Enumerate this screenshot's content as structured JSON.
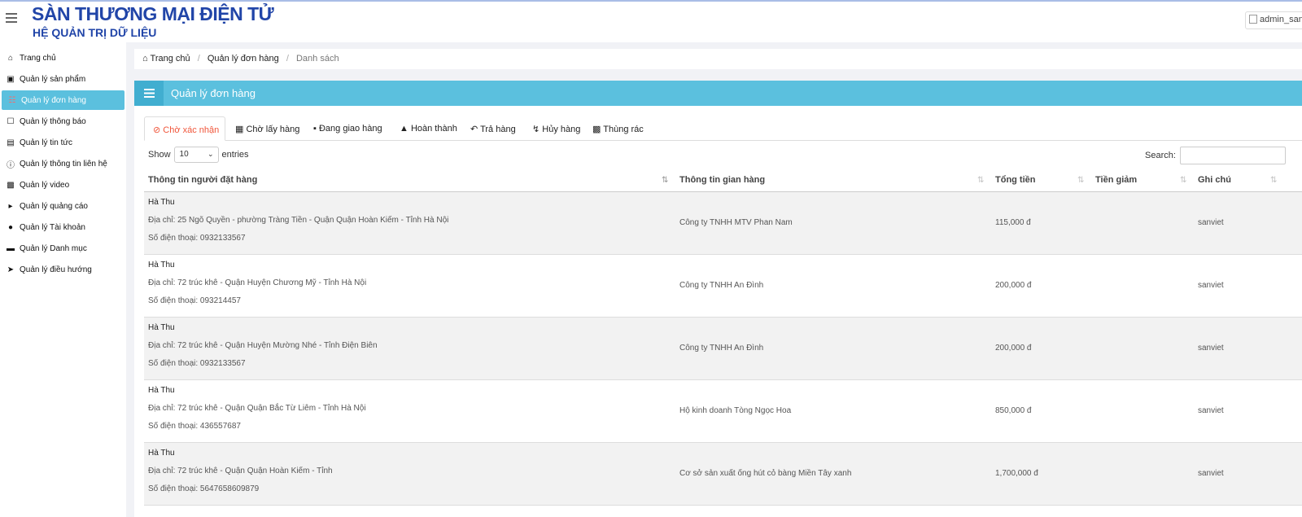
{
  "header": {
    "logo_title": "SÀN THƯƠNG MẠI ĐIỆN TỬ",
    "logo_subtitle": "HỆ QUẢN TRỊ DỮ LIỆU",
    "user_label": "admin_san"
  },
  "sidebar": {
    "items": [
      {
        "label": "Trang chủ",
        "icon": "home-icon"
      },
      {
        "label": "Quản lý sản phẩm",
        "icon": "archive-icon"
      },
      {
        "label": "Quản lý đơn hàng",
        "icon": "cart-icon",
        "active": true
      },
      {
        "label": "Quản lý thông báo",
        "icon": "bookmark-icon"
      },
      {
        "label": "Quản lý tin tức",
        "icon": "newspaper-icon"
      },
      {
        "label": "Quản lý thông tin liên hệ",
        "icon": "question-icon"
      },
      {
        "label": "Quản lý video",
        "icon": "video-icon"
      },
      {
        "label": "Quản lý quảng cáo",
        "icon": "megaphone-icon"
      },
      {
        "label": "Quản lý Tài khoản",
        "icon": "users-icon"
      },
      {
        "label": "Quản lý Danh mục",
        "icon": "folder-icon"
      },
      {
        "label": "Quản lý điều hướng",
        "icon": "location-arrow-icon"
      }
    ]
  },
  "breadcrumb": {
    "home": "Trang chủ",
    "section": "Quản lý đơn hàng",
    "current": "Danh sách"
  },
  "panel": {
    "title": "Quản lý đơn hàng"
  },
  "tabs": [
    {
      "label": "Chờ xác nhận",
      "icon": "circle-x-icon",
      "active": true
    },
    {
      "label": "Chờ lấy hàng",
      "icon": "gift-icon"
    },
    {
      "label": "Đang giao hàng",
      "icon": "truck-icon"
    },
    {
      "label": "Hoàn thành",
      "icon": "bell-icon"
    },
    {
      "label": "Trả hàng",
      "icon": "reply-icon"
    },
    {
      "label": "Hủy hàng",
      "icon": "bolt-icon"
    },
    {
      "label": "Thùng rác",
      "icon": "trash-icon"
    }
  ],
  "table_controls": {
    "show_label": "Show",
    "page_size": "10",
    "entries_label": "entries",
    "search_label": "Search:"
  },
  "columns": [
    "Thông tin người đặt hàng",
    "Thông tin gian hàng",
    "Tổng tiền",
    "Tiền giảm",
    "Ghi chú"
  ],
  "rows": [
    {
      "name": "Hà Thu",
      "address": "Địa chỉ: 25 Ngõ Quyền - phường Tràng Tiền - Quận Quận Hoàn Kiếm - Tỉnh Hà Nội",
      "phone": "Số điện thoại: 0932133567",
      "shop": "Công ty TNHH MTV Phan Nam",
      "total": "115,000 đ",
      "discount": "",
      "note": "sanviet"
    },
    {
      "name": "Hà Thu",
      "address": "Địa chỉ: 72 trúc khê - Quận Huyện Chương Mỹ - Tỉnh Hà Nội",
      "phone": "Số điện thoại: 093214457",
      "shop": "Công ty TNHH An Đình",
      "total": "200,000 đ",
      "discount": "",
      "note": "sanviet"
    },
    {
      "name": "Hà Thu",
      "address": "Địa chỉ: 72 trúc khê - Quận Huyện Mường Nhé - Tỉnh Điện Biên",
      "phone": "Số điện thoại: 0932133567",
      "shop": "Công ty TNHH An Đình",
      "total": "200,000 đ",
      "discount": "",
      "note": "sanviet"
    },
    {
      "name": "Hà Thu",
      "address": "Địa chỉ: 72 trúc khê - Quận Quận Bắc Từ Liêm - Tỉnh Hà Nội",
      "phone": "Số điện thoại: 436557687",
      "shop": "Hộ kinh doanh Tòng Ngọc Hoa",
      "total": "850,000 đ",
      "discount": "",
      "note": "sanviet"
    },
    {
      "name": "Hà Thu",
      "address": "Địa chỉ: 72 trúc khê - Quận Quận Hoàn Kiếm - Tỉnh",
      "phone": "Số điện thoại: 5647658609879",
      "shop": "Cơ sở sản xuất ống hút cỏ bàng Miền Tây xanh",
      "total": "1,700,000 đ",
      "discount": "",
      "note": "sanviet"
    }
  ]
}
